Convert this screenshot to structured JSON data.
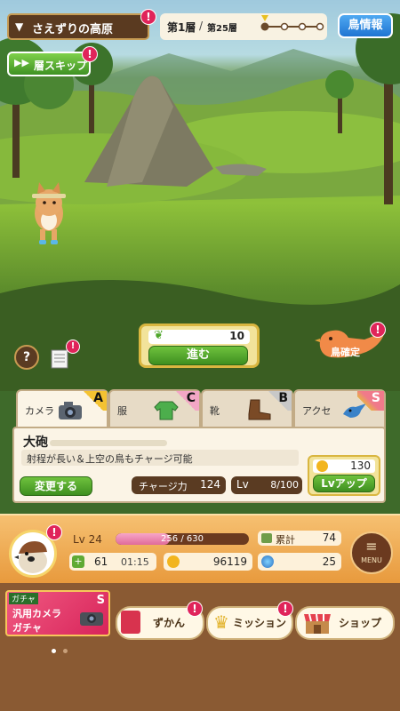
{
  "header": {
    "location": "さえずりの高原",
    "floor_current": "第1層",
    "floor_separator": "/",
    "floor_total": "第25層",
    "bird_info_button": "鳥情報",
    "skip_button": "層スキップ"
  },
  "actions": {
    "advance_count": "10",
    "advance_button": "進む",
    "confirm_bird_button": "鳥確定",
    "help_icon_text": "?"
  },
  "equipment_tabs": [
    {
      "label": "カメラ",
      "rank": "A"
    },
    {
      "label": "服",
      "rank": "C"
    },
    {
      "label": "靴",
      "rank": "B"
    },
    {
      "label": "アクセ",
      "rank": "S"
    }
  ],
  "item_detail": {
    "name": "大砲",
    "description": "射程が長い＆上空の鳥もチャージ可能",
    "change_button": "変更する",
    "charge_label": "チャージ力",
    "charge_value": "124",
    "lv_label": "Lv",
    "lv_value": "8/100",
    "upgrade_cost": "130",
    "upgrade_button": "Lvアップ"
  },
  "player": {
    "level": "Lv 24",
    "exp_text": "256 / 630",
    "exp_progress": 0.406,
    "total_label": "累計",
    "total_value": "74",
    "stamina": "61",
    "timer": "01:15",
    "coins": "96119",
    "gems": "25",
    "menu_label": "MENU"
  },
  "gacha": {
    "tag": "ガチャ",
    "title_line1": "汎用カメラ",
    "title_line2": "ガチャ",
    "rank": "S"
  },
  "nav": {
    "encyclopedia": "ずかん",
    "missions": "ミッション",
    "shop": "ショップ"
  },
  "badge_mark": "!",
  "colors": {
    "accent_green": "#4ea62a",
    "badge_pink": "#e0245a",
    "wood_brown": "#6b4526",
    "panel_cream": "#f5ecd9"
  }
}
